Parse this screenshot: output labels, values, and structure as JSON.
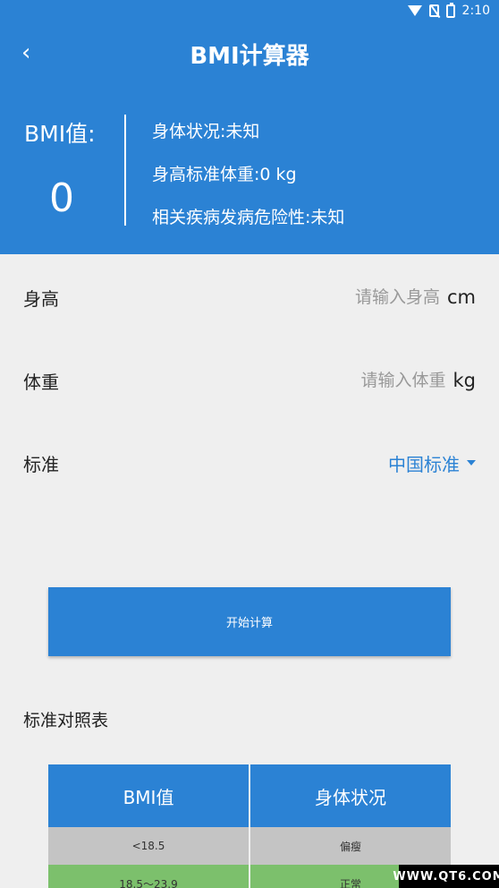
{
  "status_bar": {
    "time": "2:10"
  },
  "header": {
    "title": "BMI计算器",
    "bmi_label": "BMI值:",
    "bmi_value": "0",
    "body_status": "身体状况:未知",
    "standard_weight": "身高标准体重:0 kg",
    "disease_risk": "相关疾病发病危险性:未知"
  },
  "form": {
    "height_label": "身高",
    "height_placeholder": "请输入身高",
    "height_unit": "cm",
    "weight_label": "体重",
    "weight_placeholder": "请输入体重",
    "weight_unit": "kg",
    "standard_label": "标准",
    "standard_value": "中国标准"
  },
  "calc_button": "开始计算",
  "table": {
    "title": "标准对照表",
    "headers": [
      "BMI值",
      "身体状况"
    ],
    "rows": [
      [
        "<18.5",
        "偏瘦"
      ],
      [
        "18.5～23.9",
        "正常"
      ]
    ]
  },
  "watermark": "WWW.QT6.COM",
  "colors": {
    "primary": "#2b82d4",
    "background": "#efefef",
    "row_gray": "#c4c4c4",
    "row_green": "#7cc06c"
  }
}
